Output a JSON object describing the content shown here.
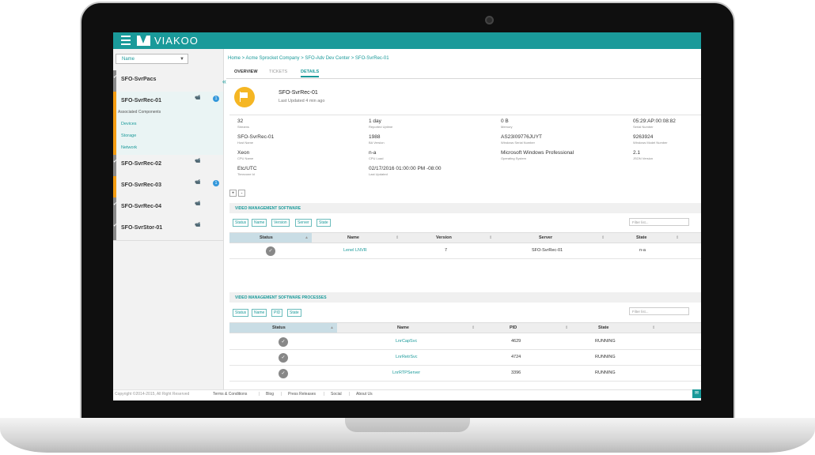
{
  "brand": {
    "name": "VIAKOO",
    "accent": "#1a9a9a"
  },
  "sidebar": {
    "dropdown_value": "Name",
    "items": [
      {
        "label": "SFO-SvrPacs",
        "status_color": "#8a8a8a",
        "badge": ""
      },
      {
        "label": "SFO-SvrRec-01",
        "status_color": "#f39c12",
        "badge": "1",
        "camera_icon": "camera-icon",
        "sub_title": "Associated Components",
        "subs": [
          "Devices",
          "Storage",
          "Network"
        ]
      },
      {
        "label": "SFO-SvrRec-02",
        "status_color": "#8a8a8a",
        "badge": ""
      },
      {
        "label": "SFO-SvrRec-03",
        "status_color": "#f39c12",
        "badge": "1"
      },
      {
        "label": "SFO-SvrRec-04",
        "status_color": "#8a8a8a",
        "badge": ""
      },
      {
        "label": "SFO-SvrStor-01",
        "status_color": "#8a8a8a",
        "badge": ""
      }
    ]
  },
  "breadcrumb": "Home > Acme Sprocket Company > SFO-Adv Dev Center > SFO-SvrRec-01",
  "tabs": [
    {
      "label": "OVERVIEW"
    },
    {
      "label": "TICKETS"
    },
    {
      "label": "DETAILS"
    }
  ],
  "header": {
    "title": "SFO-SvrRec-01",
    "subtitle": "Last Updated 4 min ago"
  },
  "details": [
    {
      "value": "32",
      "label": "Streams"
    },
    {
      "value": "1 day",
      "label": "Reported Uptime"
    },
    {
      "value": "0 B",
      "label": "Memory"
    },
    {
      "value": "05:29:AP:00:08:82",
      "label": "Serial Number"
    },
    {
      "value": "SFO-SvrRec-01",
      "label": "Host Name"
    },
    {
      "value": "1988",
      "label": "BA Version"
    },
    {
      "value": "AS23I09776JUYT",
      "label": "Windows Serial Number"
    },
    {
      "value": "9263924",
      "label": "Windows Model Number"
    },
    {
      "value": "Xeon",
      "label": "CPU Name"
    },
    {
      "value": "n-a",
      "label": "CPU Load"
    },
    {
      "value": "Microsoft Windows Professional",
      "label": "Operating System"
    },
    {
      "value": "2.1",
      "label": "JSON Version"
    },
    {
      "value": "Etc/UTC",
      "label": "Timezone Id"
    },
    {
      "value": "02/17/2016 01:00:00 PM -08:00",
      "label": "Last Updated"
    }
  ],
  "expand": {
    "plus": "+",
    "minus": "-"
  },
  "vms": {
    "title": "VIDEO MANAGEMENT SOFTWARE",
    "buttons": [
      "Status",
      "Name",
      "Version",
      "Server",
      "State"
    ],
    "filter_placeholder": "Filter list...",
    "columns": [
      "Status",
      "Name",
      "Version",
      "Server",
      "State"
    ],
    "rows": [
      {
        "name": "Lenel LNVR",
        "version": "7",
        "server": "SFO-SvrRec-01",
        "state": "n-a"
      }
    ]
  },
  "processes": {
    "title": "VIDEO MANAGEMENT SOFTWARE PROCESSES",
    "buttons": [
      "Status",
      "Name",
      "PID",
      "State"
    ],
    "filter_placeholder": "Filter list...",
    "columns": [
      "Status",
      "Name",
      "PID",
      "State"
    ],
    "rows": [
      {
        "name": "LnrCapSvc",
        "pid": "4629",
        "state": "RUNNING"
      },
      {
        "name": "LnrRetrSvc",
        "pid": "4724",
        "state": "RUNNING"
      },
      {
        "name": "LnrRTPServer",
        "pid": "3396",
        "state": "RUNNING"
      }
    ]
  },
  "footer": {
    "copyright": "Copyright ©2014-2015, All Right Reserved",
    "links": [
      "Terms & Conditions",
      "Blog",
      "Press Releases",
      "Social",
      "About Us"
    ],
    "separator": "|"
  }
}
